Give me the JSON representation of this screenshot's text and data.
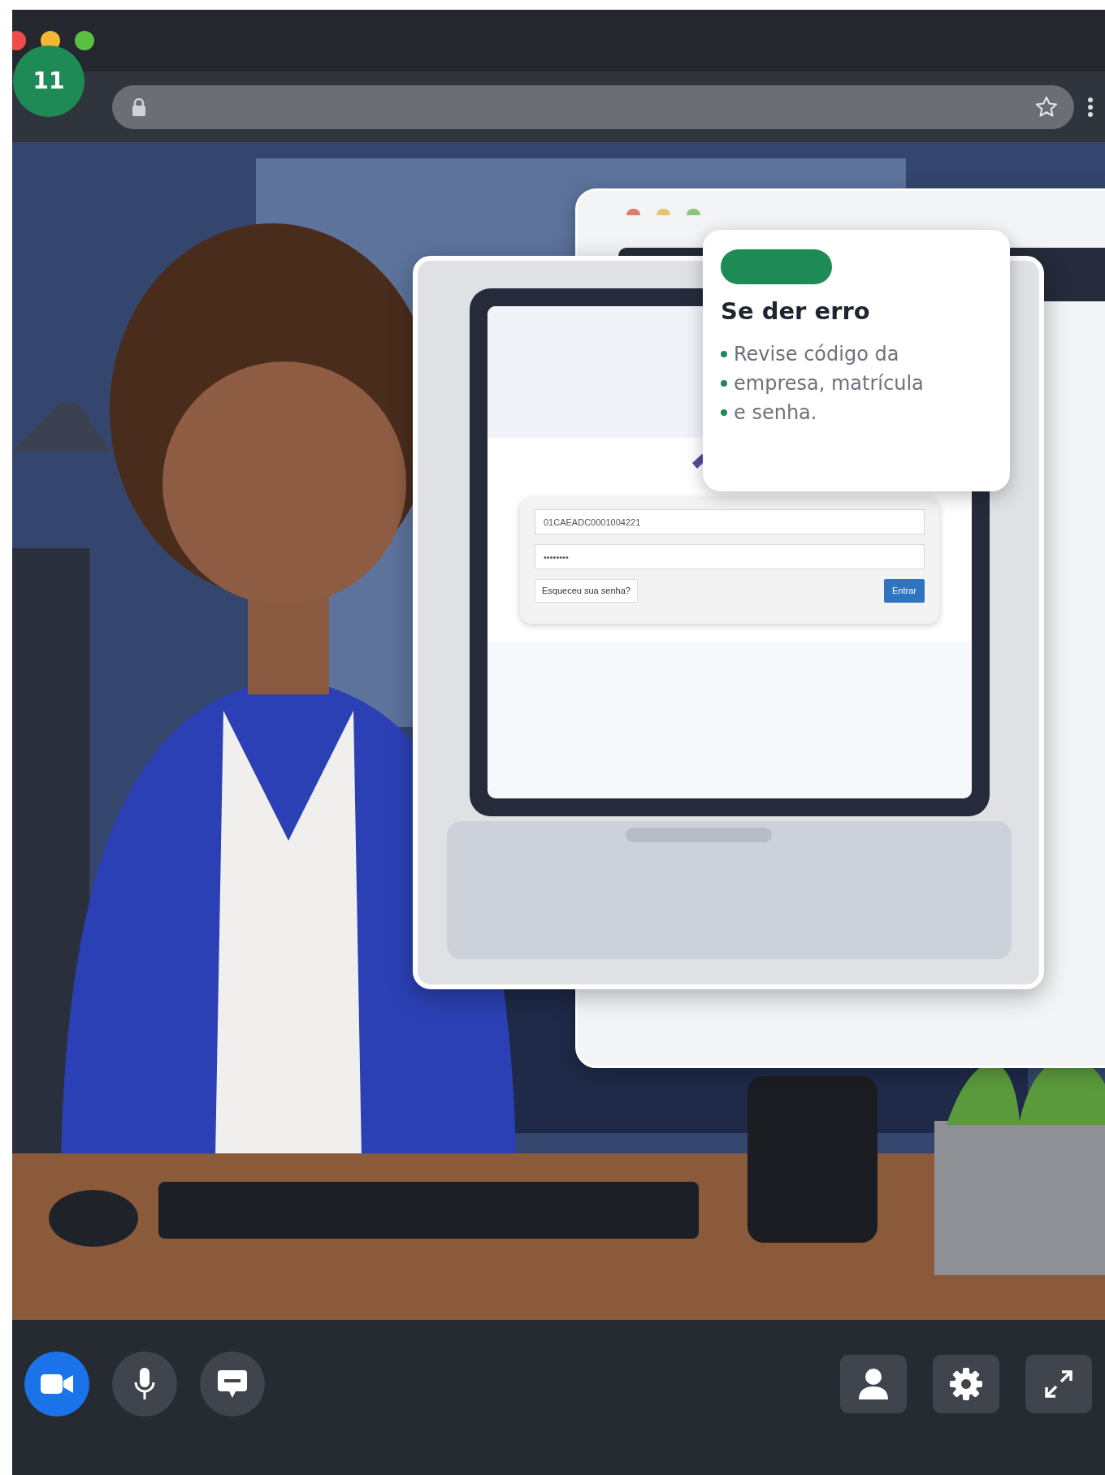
{
  "step_badge": "11",
  "login_mockup": {
    "company_field": {
      "value": "01CAEADC0001004221"
    },
    "password_field": {
      "value": "••••••••"
    },
    "forgot_button": "Esqueceu sua senha?",
    "submit_button": "Entrar"
  },
  "callout": {
    "title": "Se der erro",
    "bullets": [
      "Revise código da",
      "empresa, matrícula",
      "e senha."
    ]
  },
  "controls": {
    "left": [
      {
        "kind": "camera",
        "selected": true
      },
      {
        "kind": "microphone",
        "selected": false
      },
      {
        "kind": "chat",
        "selected": false
      }
    ],
    "right": [
      {
        "kind": "person"
      },
      {
        "kind": "settings"
      },
      {
        "kind": "fullscreen"
      }
    ]
  }
}
